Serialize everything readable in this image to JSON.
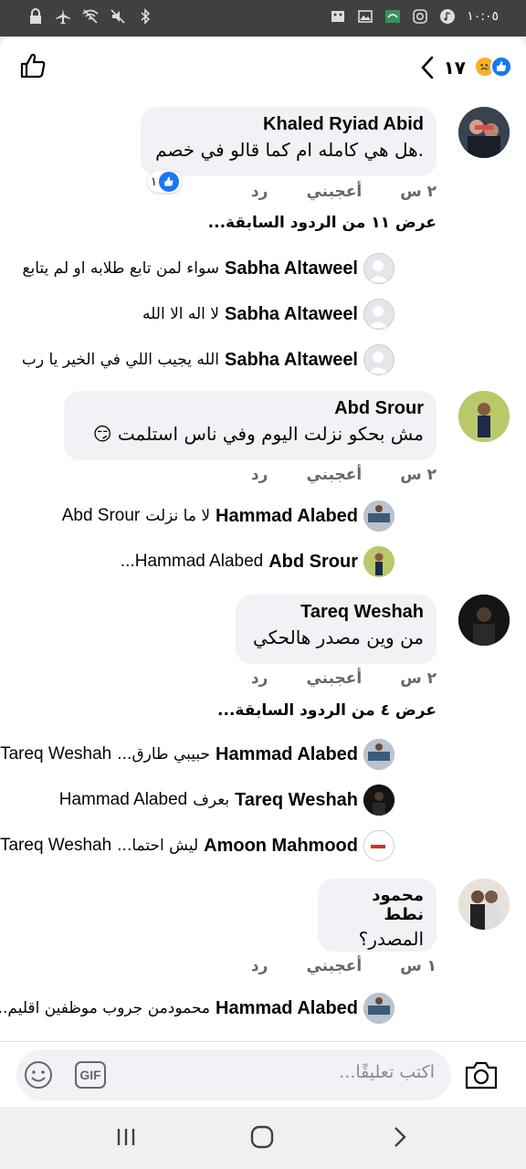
{
  "status_bar": {
    "time": "١٠:٠٥",
    "left_icons": [
      "lock-icon",
      "airplane-icon",
      "wifi-off-icon",
      "mute-icon",
      "bluetooth-icon"
    ],
    "right_icons": [
      "dnd-icon",
      "gallery-icon",
      "app-icon",
      "instagram-icon",
      "music-icon"
    ]
  },
  "header": {
    "reaction_count": "١٧",
    "reactions": [
      "like",
      "sad"
    ]
  },
  "comments": [
    {
      "author": "Khaled Ryiad Abid",
      "text": ".هل هي كامله ام كما قالو في خصم",
      "time": "٢ س",
      "like_label": "أعجبني",
      "reply_label": "رد",
      "likes": "١",
      "view_more": "عرض ١١ من الردود السابقة...",
      "replies": [
        {
          "author": "Sabha Altaweel",
          "text": "سواء لمن تابع طلابه او لم يتابع"
        },
        {
          "author": "Sabha Altaweel",
          "text": "لا اله الا الله"
        },
        {
          "author": "Sabha Altaweel",
          "text": "الله يجيب اللي في الخير يا رب"
        }
      ]
    },
    {
      "author": "Abd Srour",
      "text": "مش بحكو نزلت اليوم وفي ناس استلمت 😏",
      "time": "٢ س",
      "like_label": "أعجبني",
      "reply_label": "رد",
      "replies": [
        {
          "author": "Hammad Alabed",
          "text": "لا ما نزلت",
          "tag": "Abd Srour"
        },
        {
          "author": "Abd Srour",
          "text": "",
          "tag": "Hammad Alabed..."
        }
      ]
    },
    {
      "author": "Tareq Weshah",
      "text": "من وين مصدر هالحكي",
      "time": "٢ س",
      "like_label": "أعجبني",
      "reply_label": "رد",
      "view_more": "عرض ٤ من الردود السابقة...",
      "replies": [
        {
          "author": "Hammad Alabed",
          "text": "حبيبي طارق...",
          "tag": "Tareq Weshah"
        },
        {
          "author": "Tareq Weshah",
          "text": "بعرف",
          "tag": "Hammad Alabed"
        },
        {
          "author": "Amoon Mahmood",
          "text": "ليش احتما...",
          "tag": "Tareq Weshah"
        }
      ]
    },
    {
      "author": "محمود نطط",
      "text": "المصدر؟",
      "time": "١ س",
      "like_label": "أعجبني",
      "reply_label": "رد",
      "replies": [
        {
          "author": "Hammad Alabed",
          "text": "محمودمن جروب موظفين اقليم..."
        }
      ]
    }
  ],
  "composer": {
    "placeholder": "اكتب تعليقًا...",
    "gif_label": "GIF"
  },
  "colors": {
    "accent": "#1877f2",
    "bubble": "#f0f2f5",
    "meta_text": "#65676b"
  }
}
